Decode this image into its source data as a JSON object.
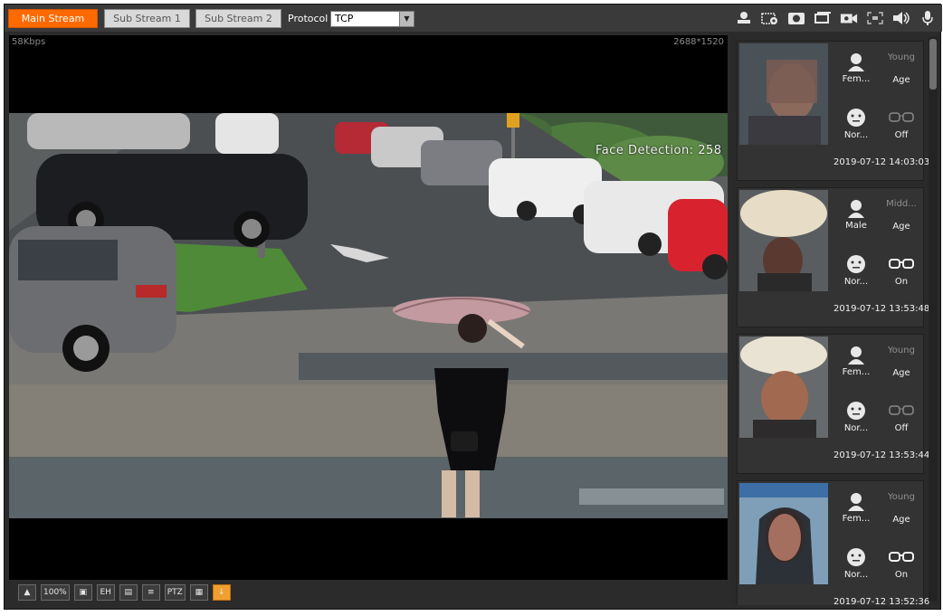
{
  "toolbar": {
    "streams": [
      "Main Stream",
      "Sub Stream 1",
      "Sub Stream 2"
    ],
    "protocol_label": "Protocol",
    "protocol_value": "TCP",
    "icons": [
      "local-record-icon",
      "snapshot-settings-icon",
      "snapshot-icon",
      "triple-snapshot-icon",
      "record-icon",
      "fullscreen-icon",
      "audio-icon",
      "microphone-icon"
    ]
  },
  "video": {
    "bitrate": "58Kbps",
    "resolution": "2688*1520",
    "overlay_text": "Face Detection: 258"
  },
  "bottom_toolbar": {
    "buttons": [
      "▲",
      "100%",
      "▣",
      "EH",
      "▤",
      "≡",
      "PTZ",
      "▦",
      "↓"
    ]
  },
  "faces": [
    {
      "gender": "Fem...",
      "age": "Young",
      "age_label": "Age",
      "expression": "Nor...",
      "glasses": "Off",
      "time": "2019-07-12 14:03:03"
    },
    {
      "gender": "Male",
      "age": "Midd...",
      "age_label": "Age",
      "expression": "Nor...",
      "glasses": "On",
      "time": "2019-07-12 13:53:48"
    },
    {
      "gender": "Fem...",
      "age": "Young",
      "age_label": "Age",
      "expression": "Nor...",
      "glasses": "Off",
      "time": "2019-07-12 13:53:44"
    },
    {
      "gender": "Fem...",
      "age": "Young",
      "age_label": "Age",
      "expression": "Nor...",
      "glasses": "On",
      "time": "2019-07-12 13:52:36"
    }
  ],
  "colors": {
    "accent": "#ff6a00",
    "panel_bg": "#2b2b2b",
    "text": "#f2f2f2"
  }
}
